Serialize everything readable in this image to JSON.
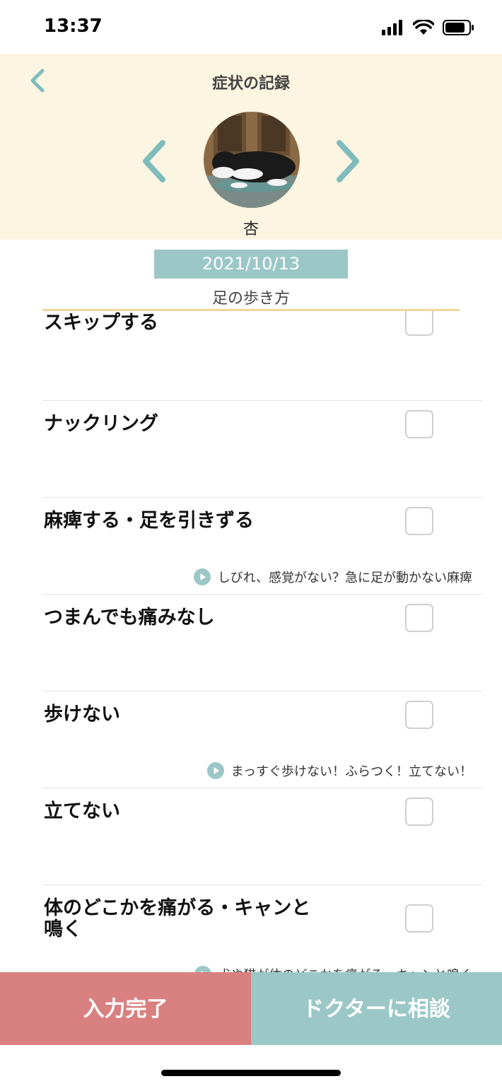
{
  "status_bar": {
    "time": "13:37"
  },
  "header": {
    "title": "症状の記録",
    "pet_name": "杏"
  },
  "record": {
    "date": "2021/10/13",
    "section": "足の歩き方"
  },
  "symptoms": [
    {
      "label": "スキップする",
      "note": ""
    },
    {
      "label": "ナックリング",
      "note": ""
    },
    {
      "label": "麻痺する・足を引きずる",
      "note": "しびれ、感覚がない？急に足が動かない麻痺"
    },
    {
      "label": "つまんでも痛みなし",
      "note": ""
    },
    {
      "label": "歩けない",
      "note": "まっすぐ歩けない！ふらつく！立てない！"
    },
    {
      "label": "立てない",
      "note": ""
    },
    {
      "label": "体のどこかを痛がる・キャンと\n鳴く",
      "note": "犬や猫が体のどこかを痛がる、キャンと鳴く"
    }
  ],
  "footer": {
    "complete_label": "入力完了",
    "doctor_label": "ドクターに相談"
  },
  "colors": {
    "accent": "#9cc7c7",
    "complete": "#d98180",
    "header_bg": "#fcf5e2",
    "underline": "#f1d59a"
  }
}
